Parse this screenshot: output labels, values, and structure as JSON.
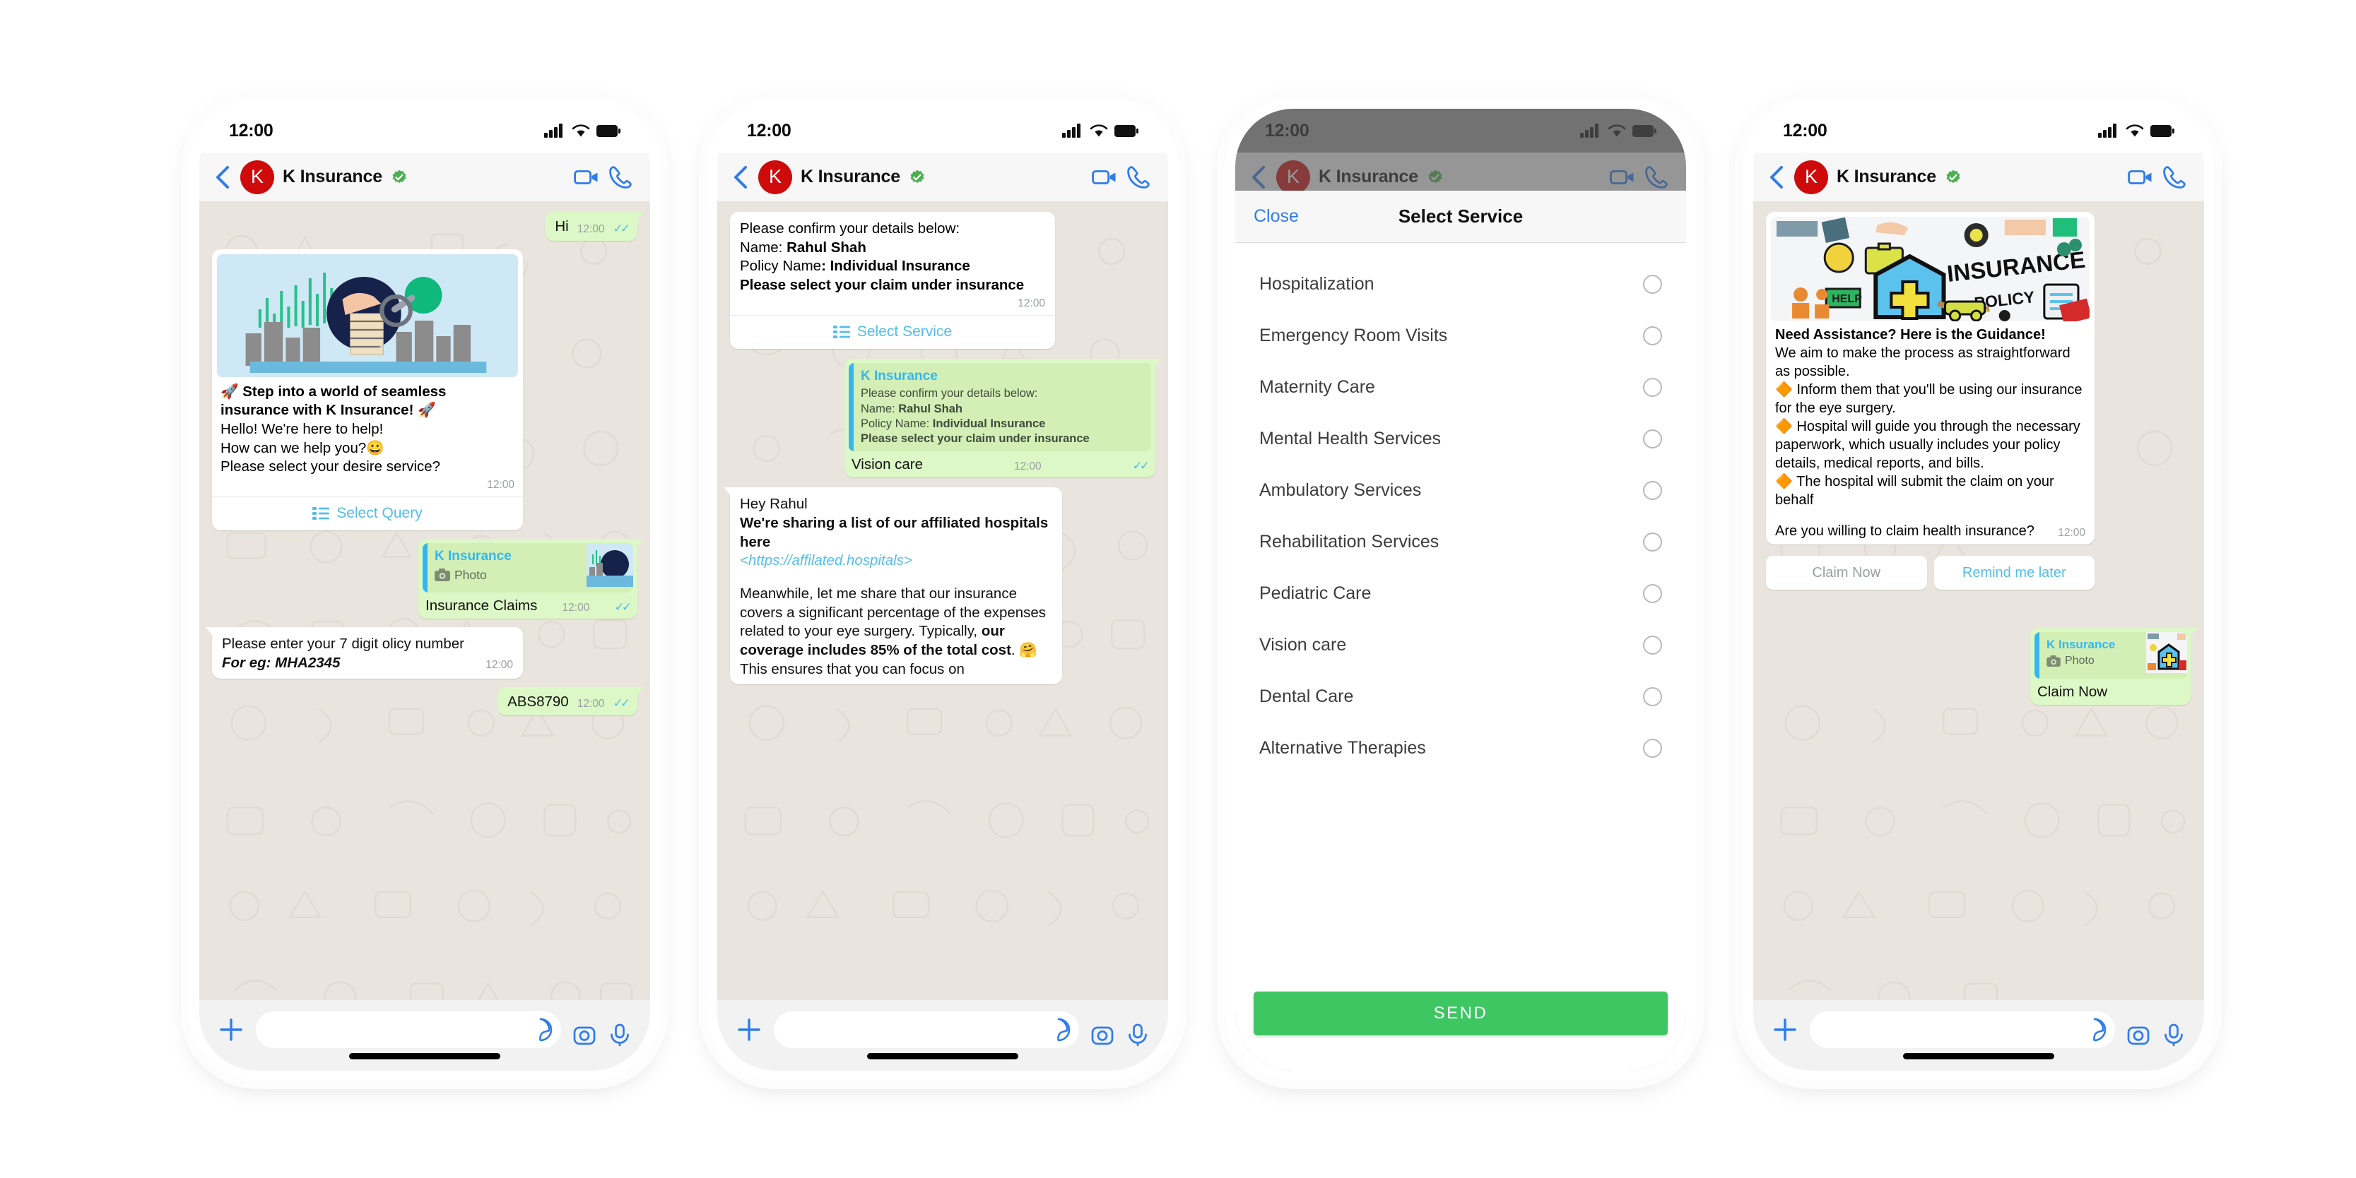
{
  "status_bar": {
    "time": "12:00"
  },
  "header": {
    "avatar_letter": "K",
    "contact_name": "K Insurance",
    "back_icon": "back-chevron-icon",
    "verified_icon": "verified-badge-icon",
    "video_icon": "video-call-icon",
    "call_icon": "voice-call-icon"
  },
  "input_bar": {
    "plus_icon": "plus-icon",
    "placeholder": "",
    "value": "",
    "sticker_icon": "sticker-icon",
    "camera_icon": "camera-icon",
    "mic_icon": "microphone-icon"
  },
  "colors": {
    "brand_red": "#cf0a0a",
    "outgoing_bubble": "#dcf8c6",
    "quoted_bubble": "#d3efb5",
    "link_blue": "#53bdeb",
    "accent_blue": "#2f7ced",
    "send_green": "#3ec662",
    "verified_green": "#4caf50",
    "chat_bg": "#e9e4dd"
  },
  "phone1": {
    "messages": {
      "hi": {
        "text": "Hi",
        "time": "12:00",
        "ticks": "✓✓"
      },
      "welcome_card": {
        "image_alt": "insurance-banner-image",
        "headline": "🚀 Step into a world of seamless insurance with K Insurance! 🚀",
        "line1": "Hello! We're here to help!",
        "line2": "How can we help you?😀",
        "line3": "Please select your desire service?",
        "time": "12:00",
        "button_label": "Select Query",
        "button_icon": "list-icon"
      },
      "claims_reply": {
        "quote_title": "K Insurance",
        "quote_kind": "Photo",
        "quote_icon": "camera-icon",
        "text": "Insurance Claims",
        "time": "12:00",
        "ticks": "✓✓"
      },
      "policy_prompt": {
        "line1": "Please enter your 7 digit olicy number",
        "line2": "For eg: MHA2345",
        "time": "12:00"
      },
      "policy_answer": {
        "text": "ABS8790",
        "time": "12:00",
        "ticks": "✓✓"
      }
    }
  },
  "phone2": {
    "messages": {
      "confirm_card": {
        "line1": "Please confirm your details below:",
        "line2_label": "Name: ",
        "line2_value": "Rahul Shah",
        "line3_label": "Policy Name",
        "line3_value": ": Individual Insurance",
        "line4": "Please select your claim under insurance",
        "time": "12:00",
        "button_label": "Select Service",
        "button_icon": "list-icon"
      },
      "vision_reply": {
        "quote_title": "K Insurance",
        "q1": "Please confirm your details below:",
        "q2_label": "Name: ",
        "q2_value": "Rahul Shah",
        "q3_label": "Policy Name: ",
        "q3_value": "Individual Insurance",
        "q4": "Please select your claim under insurance",
        "text": "Vision care",
        "time": "12:00",
        "ticks": "✓✓"
      },
      "hospitals": {
        "line1": "Hey Rahul",
        "line2": "We're sharing a list of our affiliated hospitals here",
        "link": "<https://affilated.hospitals>",
        "para_a": "Meanwhile, let me share that our insurance covers a significant percentage of the expenses related to your eye surgery. Typically, ",
        "para_b": "our coverage includes 85% of the total cost",
        "para_c": ". 🤗",
        "para_d": "This ensures that you can focus on"
      }
    }
  },
  "phone3": {
    "modal": {
      "close_label": "Close",
      "title": "Select Service",
      "send_label": "SEND",
      "options": [
        "Hospitalization",
        "Emergency Room Visits",
        "Maternity Care",
        "Mental Health Services",
        "Ambulatory Services",
        "Rehabilitation Services",
        "Pediatric Care",
        "Vision care",
        "Dental Care",
        "Alternative Therapies"
      ]
    }
  },
  "phone4": {
    "messages": {
      "guidance": {
        "image_alt": "insurance-policy-collage-image",
        "headline": "Need Assistance? Here is the Guidance!",
        "line1": "We aim to make the process as straightforward as possible.",
        "bullet1": "🔶 Inform them that you'll be using our insurance for the eye surgery.",
        "bullet2": "🔶 Hospital will guide you through the necessary paperwork, which usually includes your policy details, medical reports, and bills.",
        "bullet3": "🔶 The hospital will submit the claim on your behalf",
        "question": "Are you willing to claim health insurance?",
        "time": "12:00"
      },
      "reply_buttons": {
        "primary": "Claim Now",
        "secondary": "Remind me later"
      },
      "claim_reply": {
        "quote_title": "K Insurance",
        "quote_kind": "Photo",
        "quote_icon": "camera-icon",
        "text": "Claim Now"
      }
    }
  }
}
